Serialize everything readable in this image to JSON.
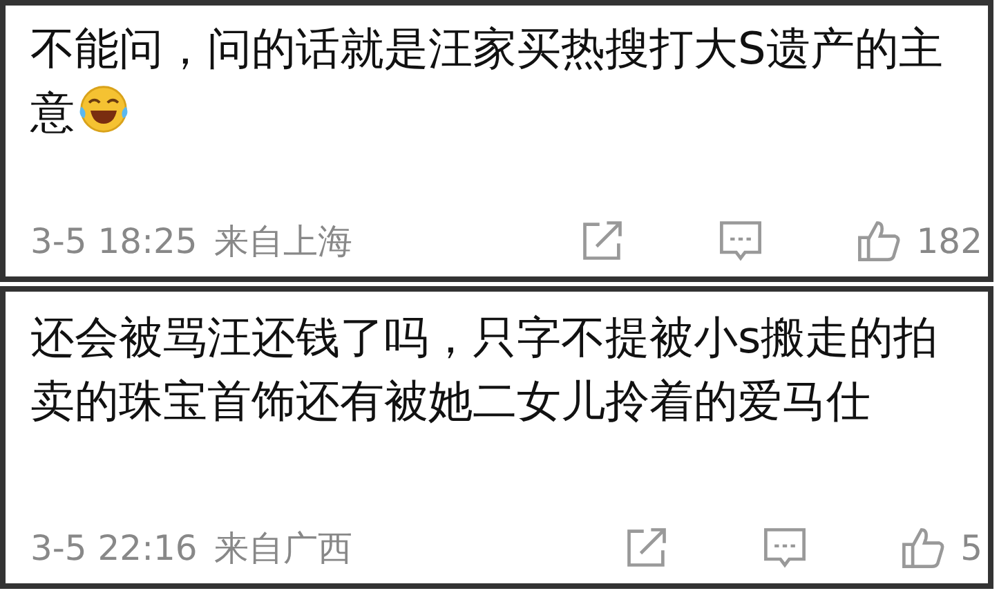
{
  "comments": [
    {
      "text": "不能问，问的话就是汪家买热搜打大S遗产的主意",
      "emoji": true,
      "time": "3-5 18:25",
      "location": "来自上海",
      "likes": "182"
    },
    {
      "text": "还会被骂汪还钱了吗，只字不提被小s搬走的拍卖的珠宝首饰还有被她二女儿拎着的爱马仕",
      "emoji": false,
      "time": "3-5 22:16",
      "location": "来自广西",
      "likes": "5"
    }
  ]
}
